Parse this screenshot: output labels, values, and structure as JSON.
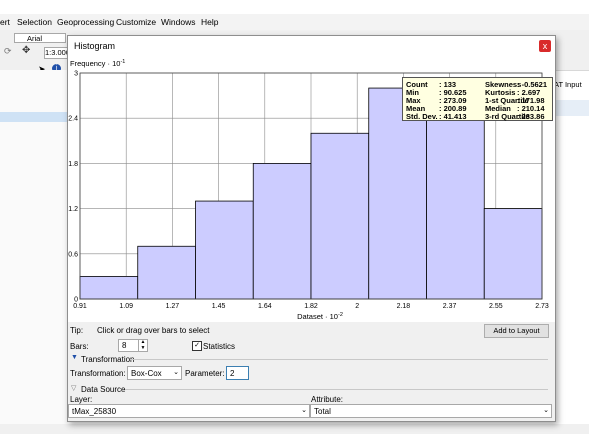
{
  "app": {
    "menu": [
      "ert",
      "Selection",
      "Geoprocessing",
      "Customize",
      "Windows",
      "Help"
    ],
    "font_name": "Arial",
    "font_size": "10",
    "scale": "1:3.000",
    "right_dropdown": "AT Input"
  },
  "dialog": {
    "title": "Histogram",
    "close_glyph": "x",
    "tip_label": "Tip:",
    "tip_text": "Click or drag over bars to select",
    "add_to_layout": "Add to Layout",
    "bars_label": "Bars:",
    "bars_value": "8",
    "statistics_label": "Statistics",
    "statistics_checked": true,
    "transformation_section": "Transformation",
    "transformation_label": "Transformation:",
    "transformation_value": "Box-Cox",
    "parameter_label": "Parameter:",
    "parameter_value": "2",
    "datasource_section": "Data Source",
    "layer_label": "Layer:",
    "layer_value": "tMax_25830",
    "attribute_label": "Attribute:",
    "attribute_value": "Total"
  },
  "stats": {
    "count_label": "Count",
    "count_value": ": 133",
    "min_label": "Min",
    "min_value": ": 90.625",
    "max_label": "Max",
    "max_value": ": 273.09",
    "mean_label": "Mean",
    "mean_value": ": 200.89",
    "std_label": "Std. Dev.",
    "std_value": ": 41.413",
    "skew_label": "Skewness",
    "skew_value": ": -0.5621",
    "kurt_label": "Kurtosis",
    "kurt_value": ": 2.697",
    "q1_label": "1-st Quartile",
    "q1_value": ": 171.98",
    "median_label": "Median",
    "median_value": ": 210.14",
    "q3_label": "3-rd Quartile",
    "q3_value": ": 233.86"
  },
  "chart_data": {
    "type": "bar",
    "ylabel": "Frequency",
    "ylabel_exp": "-1",
    "xlabel": "Dataset",
    "xlabel_exp": "-2",
    "x_ticks": [
      "0.91",
      "1.09",
      "1.27",
      "1.45",
      "1.64",
      "1.82",
      "2",
      "2.18",
      "2.37",
      "2.55",
      "2.73"
    ],
    "y_ticks": [
      "0",
      "0.6",
      "1.2",
      "1.8",
      "2.4",
      "3"
    ],
    "ylim": [
      0,
      3
    ],
    "values": [
      0.3,
      0.7,
      1.3,
      1.8,
      2.2,
      2.8,
      2.9,
      1.2
    ],
    "bar_color": "#ccccff",
    "grid": true
  }
}
